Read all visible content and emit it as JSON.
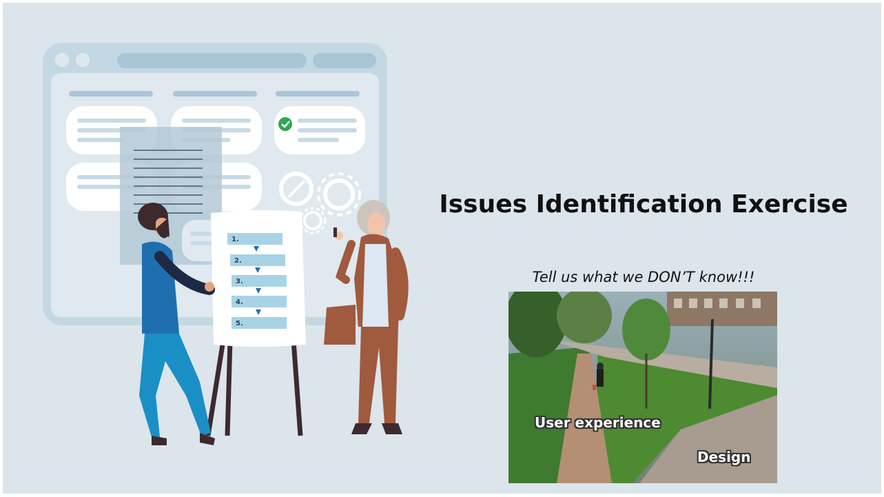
{
  "slide": {
    "title": "Issues Identification Exercise",
    "subtitle": "Tell us what we DON’T know!!!"
  },
  "illustration": {
    "flipchart_steps": [
      "1.",
      "2.",
      "3.",
      "4.",
      "5."
    ],
    "icons": [
      "browser-window-icon",
      "checkmark-icon",
      "gear-icon",
      "compass-icon"
    ]
  },
  "photo": {
    "labels": {
      "user_experience": "User experience",
      "design": "Design"
    }
  },
  "colors": {
    "background": "#dce5eb",
    "window": "#c6d9e4",
    "accent_blue": "#1f6fb0",
    "step_box": "#a8d3e6",
    "check_green": "#2ea84f"
  }
}
